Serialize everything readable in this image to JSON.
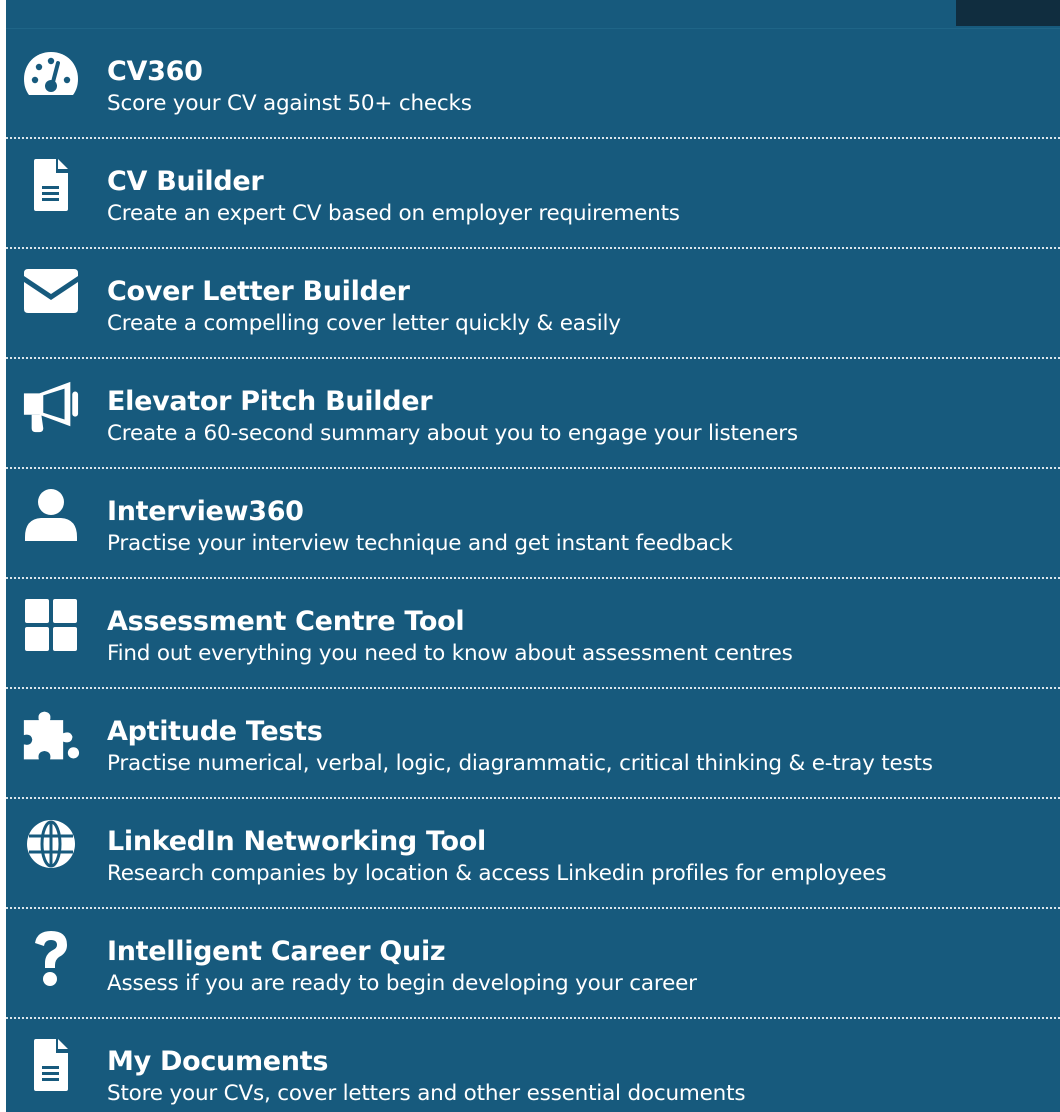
{
  "menu": {
    "items": [
      {
        "icon": "speedometer-icon",
        "title": "CV360",
        "subtitle": "Score your CV against 50+ checks"
      },
      {
        "icon": "document-icon",
        "title": "CV Builder",
        "subtitle": "Create an expert CV based on employer requirements"
      },
      {
        "icon": "envelope-icon",
        "title": "Cover Letter Builder",
        "subtitle": "Create a compelling cover letter quickly & easily"
      },
      {
        "icon": "megaphone-icon",
        "title": "Elevator Pitch Builder",
        "subtitle": "Create a 60-second summary about you to engage your listeners"
      },
      {
        "icon": "user-icon",
        "title": "Interview360",
        "subtitle": "Practise your interview technique and get instant feedback"
      },
      {
        "icon": "grid-icon",
        "title": "Assessment Centre Tool",
        "subtitle": "Find out everything you need to know about assessment centres"
      },
      {
        "icon": "puzzle-icon",
        "title": "Aptitude Tests",
        "subtitle": "Practise numerical, verbal, logic, diagrammatic, critical thinking & e-tray tests"
      },
      {
        "icon": "globe-icon",
        "title": "LinkedIn Networking Tool",
        "subtitle": "Research companies by location & access Linkedin profiles for employees"
      },
      {
        "icon": "question-icon",
        "title": "Intelligent Career Quiz",
        "subtitle": "Assess if you are ready to begin developing your career"
      },
      {
        "icon": "document-icon",
        "title": "My Documents",
        "subtitle": "Store your CVs, cover letters and other essential documents"
      }
    ]
  },
  "colors": {
    "panel_background": "#175a7d",
    "corner_block": "#102d3f",
    "text": "#ffffff"
  }
}
